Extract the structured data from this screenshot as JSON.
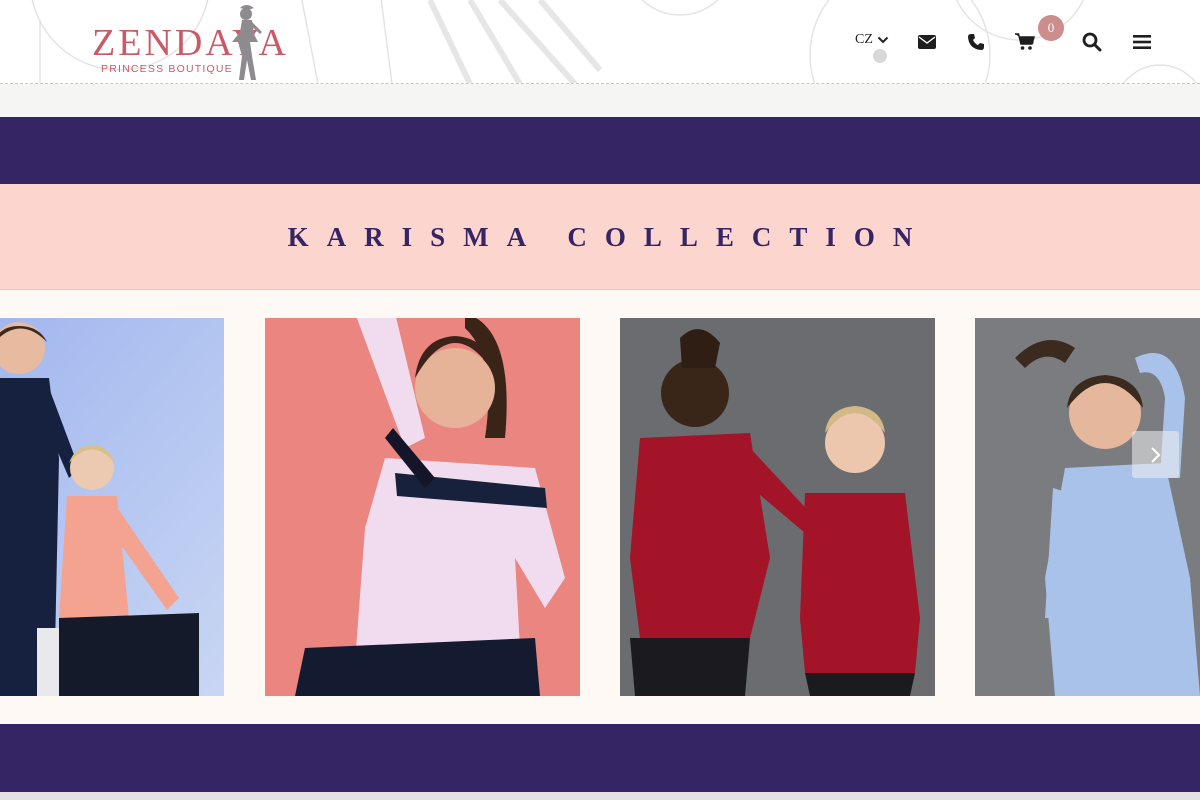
{
  "header": {
    "logo": {
      "word": "ZENDAYA",
      "subtitle": "PRINCESS BOUTIQUE",
      "brand_color": "#c95a68"
    },
    "language": {
      "selected": "CZ",
      "icon": "chevron-down-icon"
    },
    "icons": {
      "email": "envelope-icon",
      "phone": "phone-icon",
      "cart": "shopping-cart-icon",
      "search": "search-icon",
      "menu": "hamburger-menu-icon"
    },
    "cart_count": "0",
    "badge_color": "#cc8e8c"
  },
  "collection": {
    "title": "KARISMA COLLECTION",
    "band_color": "#352564",
    "title_bg": "#fcd5cf"
  },
  "gallery": {
    "next_icon": "chevron-right-icon",
    "slides": [
      {
        "background": "#8fa9e8"
      },
      {
        "background": "#e8837d"
      },
      {
        "background": "#6d6e70"
      },
      {
        "background": "#7a7b7e"
      }
    ]
  }
}
